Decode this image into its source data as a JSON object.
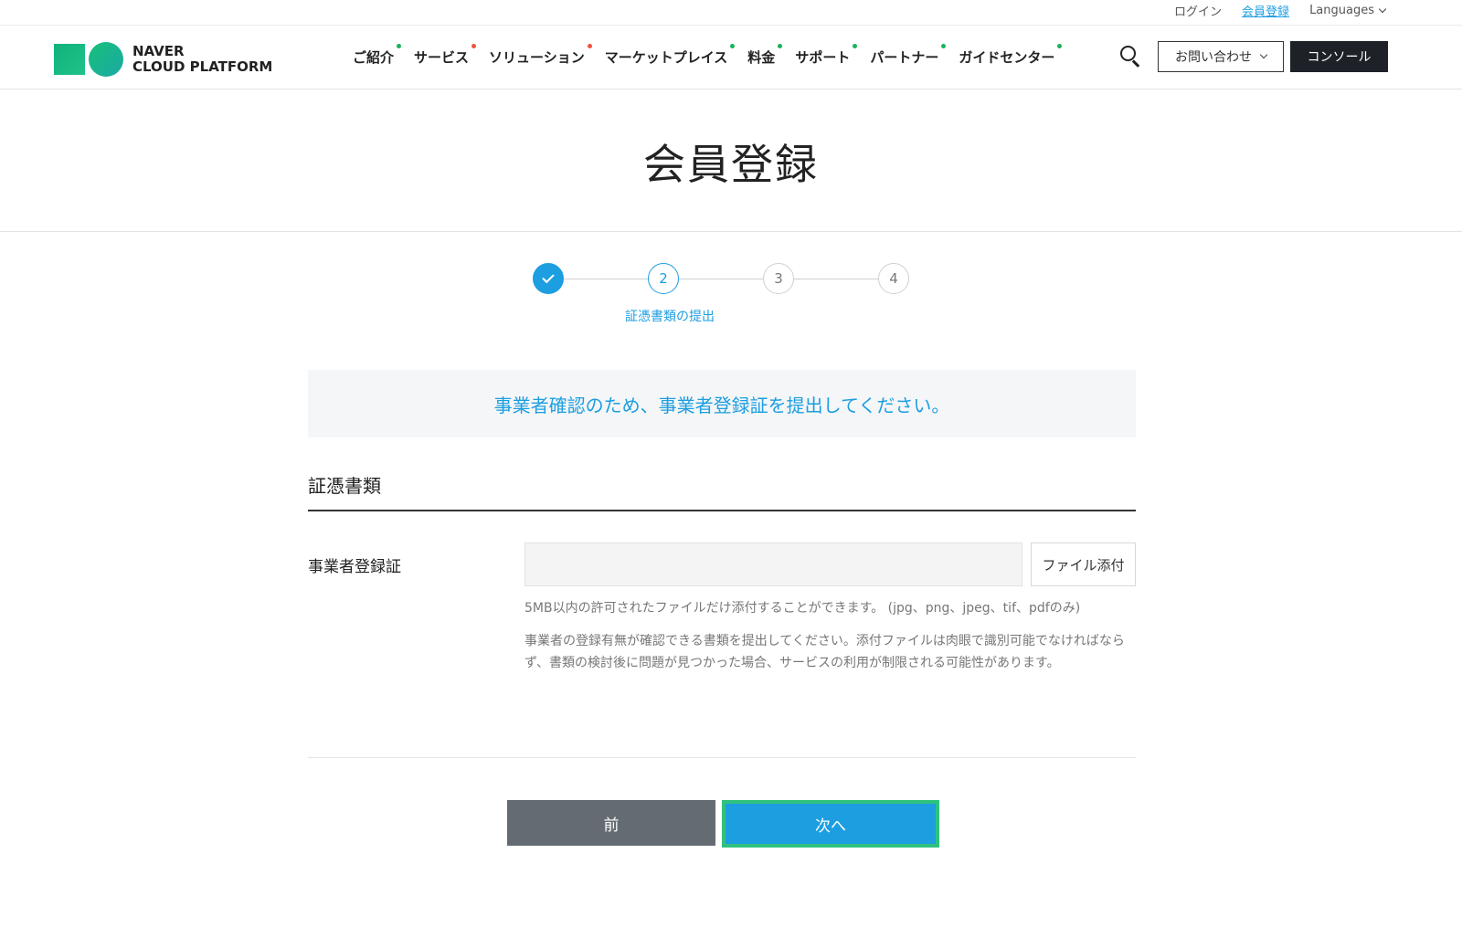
{
  "topbar": {
    "login": "ログイン",
    "signup": "会員登録",
    "languages": "Languages"
  },
  "header": {
    "logo_line1": "NAVER",
    "logo_line2": "CLOUD PLATFORM",
    "nav": [
      {
        "label": "ご紹介",
        "dot": "green"
      },
      {
        "label": "サービス",
        "dot": "red"
      },
      {
        "label": "ソリューション",
        "dot": "red"
      },
      {
        "label": "マーケットプレイス",
        "dot": "green"
      },
      {
        "label": "料金",
        "dot": "green"
      },
      {
        "label": "サポート",
        "dot": "green"
      },
      {
        "label": "パートナー",
        "dot": "green"
      },
      {
        "label": "ガイドセンター",
        "dot": "green"
      }
    ],
    "contact": "お問い合わせ",
    "console": "コンソール"
  },
  "page": {
    "title": "会員登録"
  },
  "stepper": {
    "steps": [
      "",
      "2",
      "3",
      "4"
    ],
    "active_label": "証憑書類の提出"
  },
  "form": {
    "notice": "事業者確認のため、事業者登録証を提出してください。",
    "section_title": "証憑書類",
    "field_label": "事業者登録証",
    "file_value": "",
    "file_button": "ファイル添付",
    "hint_size": "5MB以内の許可されたファイルだけ添付することができます。 (jpg、png、jpeg、tif、pdfのみ)",
    "hint_note": "事業者の登録有無が確認できる書類を提出してください。添付ファイルは肉眼で識別可能でなければならず、書類の検討後に問題が見つかった場合、サービスの利用が制限される可能性があります。"
  },
  "buttons": {
    "prev": "前",
    "next": "次へ"
  },
  "colors": {
    "accent": "#1d9ee0",
    "highlight": "#2ec27e",
    "dark": "#1e2228"
  }
}
